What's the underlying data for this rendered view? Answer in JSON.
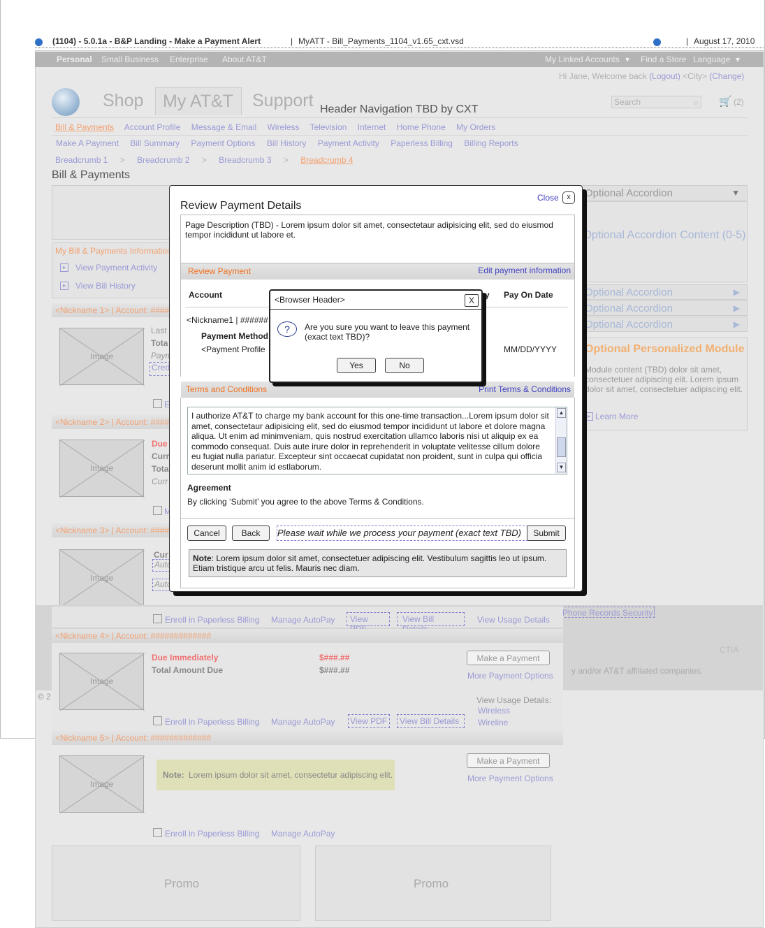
{
  "titlebar": {
    "title": "(1104) - 5.0.1a - B&P Landing - Make a Payment Alert",
    "file": "MyATT - Bill_Payments_1104_v1.65_cxt.vsd",
    "date": "August 17, 2010",
    "sep1": "|",
    "sep2": "|"
  },
  "topnav": {
    "left": [
      "Personal",
      "Small Business",
      "Enterprise",
      "About AT&T"
    ],
    "right": [
      "My Linked Accounts",
      "Find a Store",
      "Language"
    ]
  },
  "welcome": {
    "greeting": "Hi Jane, Welcome back",
    "logout": "(Logout)",
    "city": "<City>",
    "change": "(Change)"
  },
  "header": {
    "tabs": [
      "Shop",
      "My AT&T",
      "Support"
    ],
    "nav_tbd": "Header Navigation TBD by CXT",
    "search_placeholder": "Search",
    "cart_count": "(2)"
  },
  "subnav1": [
    "Bill & Payments",
    "Account Profile",
    "Message & Email",
    "Wireless",
    "Television",
    "Internet",
    "Home Phone",
    "My Orders"
  ],
  "subnav2": [
    "Make A Payment",
    "Bill Summary",
    "Payment Options",
    "Bill History",
    "Payment Activity",
    "Paperless Billing",
    "Billing Reports"
  ],
  "breadcrumbs": [
    "Breadcrumb 1",
    "Breadcrumb 2",
    "Breadcrumb 3",
    "Breadcrumb 4"
  ],
  "breadcrumb_sep": ">",
  "page_title": "Bill & Payments",
  "left_panel": {
    "info_title": "My Bill & Payments Information",
    "links": [
      "View Payment Activity",
      "View Bill History"
    ]
  },
  "image_label": "Image",
  "accounts": [
    {
      "header": "<Nickname 1> | Account: ####",
      "lines": [
        "Last",
        "Tota",
        "Paym",
        "Cred"
      ],
      "footer": "E"
    },
    {
      "header": "<Nickname 2> | Account: ####",
      "lines": [
        "Due",
        "Curr",
        "Tota",
        "Curr"
      ],
      "footer": "M"
    },
    {
      "header": "<Nickname 3> | Account: ####",
      "lines": [
        "Cur",
        "Auto",
        "Auto"
      ],
      "footer_links": [
        "Enroll in Paperless Billing",
        "Manage AutoPay",
        "View PDF",
        "View Bill Details",
        "View Usage Details"
      ]
    },
    {
      "header": "<Nickname 4> | Account: #############",
      "due": "Due Immediately",
      "total": "Total Amount Due",
      "amt1": "$###.##",
      "amt2": "$###.##",
      "make_payment": "Make a Payment",
      "more_options": "More Payment Options",
      "usage_label": "View Usage Details:",
      "usage_links": [
        "Wireless",
        "Wireline"
      ],
      "footer_links": [
        "Enroll in Paperless Billing",
        "Manage AutoPay",
        "View PDF",
        "View Bill Details"
      ]
    },
    {
      "header": "<Nickname 5> | Account: #############",
      "note_label": "Note:",
      "note_text": "Lorem ipsum dolor sit amet, consectetur adipiscing elit.",
      "make_payment": "Make a Payment",
      "more_options": "More Payment Options",
      "footer_links": [
        "Enroll in Paperless Billing",
        "Manage AutoPay"
      ]
    }
  ],
  "right_panel": {
    "accordion_title": "Optional Accordion",
    "accordion_content": "Optional Accordion Content (0-5)",
    "accordion_items": [
      "Optional Accordion",
      "Optional Accordion",
      "Optional Accordion"
    ],
    "module_title": "Optional Personalized Module",
    "module_text": "Module content (TBD) dolor sit amet, consectetuer adipiscing elit. Lorem ipsum dolor sit amet, consectetuer adipiscing elit.",
    "learn_more": "Learn More",
    "records_link": "Phone Records Security",
    "ctia": "CTIA",
    "affiliates": "y and/or AT&T affiliated companies.",
    "copyright": "© 2"
  },
  "promos": [
    "Promo",
    "Promo"
  ],
  "modal": {
    "close": "Close",
    "close_x": "x",
    "title": "Review Payment Details",
    "description": "Page Description (TBD) - Lorem ipsum dolor sit amet, consectetaur adipisicing elit, sed do eiusmod tempor incididunt ut labore et.",
    "review_header": "Review Payment",
    "edit_link": "Edit payment information",
    "col_account": "Account",
    "col_y": "y",
    "col_pay_on_date": "Pay On Date",
    "nickname_row": "<Nickname1 | ######",
    "payment_method": "Payment Method",
    "payment_profile": "<Payment Profile",
    "date": "MM/DD/YYYY",
    "terms_header": "Terms and Conditions",
    "print_link": "Print Terms & Conditions",
    "terms_text": "I authorize AT&T to charge my bank account for this one-time transaction...Lorem ipsum dolor sit amet, consectetaur adipisicing elit, sed do eiusmod tempor incididunt ut labore et dolore magna aliqua. Ut enim ad minimveniam, quis nostrud exercitation ullamco laboris nisi ut aliquip ex ea commodo consequat. Duis aute irure dolor in reprehenderit in voluptate velitesse cillum dolore eu fugiat nulla pariatur. Excepteur sint occaecat cupidatat non proident, sunt in culpa qui officia deserunt mollit anim id estlaborum.",
    "agreement_title": "Agreement",
    "agreement_text": "By clicking ‘Submit’ you agree to the above Terms & Conditions.",
    "cancel": "Cancel",
    "back": "Back",
    "wait_text": "Please wait while we process your payment (exact text TBD)",
    "submit": "Submit",
    "note_label": "Note",
    "note_text": ": Lorem ipsum dolor sit amet, consectetuer adipiscing elit. Vestibulum sagittis leo ut ipsum. Etiam tristique arcu ut felis. Mauris nec diam."
  },
  "dialog": {
    "header": "<Browser Header>",
    "close": "X",
    "question_icon": "?",
    "message": "Are you sure you want to leave this payment (exact text TBD)?",
    "yes": "Yes",
    "no": "No"
  }
}
